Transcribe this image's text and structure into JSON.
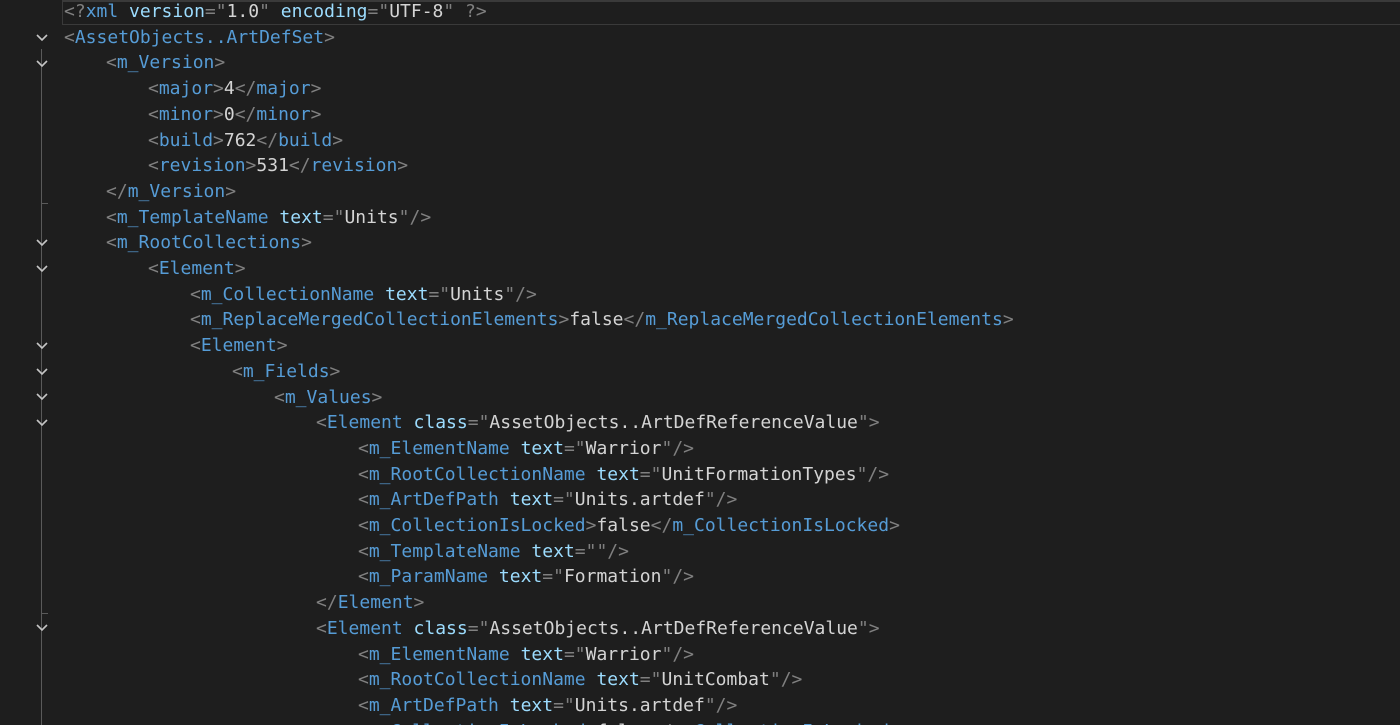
{
  "editor": {
    "lines": [
      {
        "kind": "decl",
        "text": "<?xml version=\"1.0\" encoding=\"UTF-8\" ?>"
      },
      {
        "kind": "open",
        "name": "AssetObjects..ArtDefSet"
      },
      {
        "kind": "open",
        "name": "m_Version"
      },
      {
        "kind": "value",
        "name": "major",
        "value": "4"
      },
      {
        "kind": "value",
        "name": "minor",
        "value": "0"
      },
      {
        "kind": "value",
        "name": "build",
        "value": "762"
      },
      {
        "kind": "value",
        "name": "revision",
        "value": "531"
      },
      {
        "kind": "close",
        "name": "m_Version"
      },
      {
        "kind": "selfclose",
        "name": "m_TemplateName",
        "attr": "text",
        "attrValue": "Units"
      },
      {
        "kind": "open",
        "name": "m_RootCollections"
      },
      {
        "kind": "open",
        "name": "Element"
      },
      {
        "kind": "selfclose",
        "name": "m_CollectionName",
        "attr": "text",
        "attrValue": "Units"
      },
      {
        "kind": "value",
        "name": "m_ReplaceMergedCollectionElements",
        "value": "false"
      },
      {
        "kind": "open",
        "name": "Element"
      },
      {
        "kind": "open",
        "name": "m_Fields"
      },
      {
        "kind": "open",
        "name": "m_Values"
      },
      {
        "kind": "openattr",
        "name": "Element",
        "attr": "class",
        "attrValue": "AssetObjects..ArtDefReferenceValue"
      },
      {
        "kind": "selfclose",
        "name": "m_ElementName",
        "attr": "text",
        "attrValue": "Warrior"
      },
      {
        "kind": "selfclose",
        "name": "m_RootCollectionName",
        "attr": "text",
        "attrValue": "UnitFormationTypes"
      },
      {
        "kind": "selfclose",
        "name": "m_ArtDefPath",
        "attr": "text",
        "attrValue": "Units.artdef"
      },
      {
        "kind": "value",
        "name": "m_CollectionIsLocked",
        "value": "false"
      },
      {
        "kind": "selfclose",
        "name": "m_TemplateName",
        "attr": "text",
        "attrValue": ""
      },
      {
        "kind": "selfclose",
        "name": "m_ParamName",
        "attr": "text",
        "attrValue": "Formation"
      },
      {
        "kind": "close",
        "name": "Element"
      },
      {
        "kind": "openattr",
        "name": "Element",
        "attr": "class",
        "attrValue": "AssetObjects..ArtDefReferenceValue"
      },
      {
        "kind": "selfclose",
        "name": "m_ElementName",
        "attr": "text",
        "attrValue": "Warrior"
      },
      {
        "kind": "selfclose",
        "name": "m_RootCollectionName",
        "attr": "text",
        "attrValue": "UnitCombat"
      },
      {
        "kind": "selfclose",
        "name": "m_ArtDefPath",
        "attr": "text",
        "attrValue": "Units.artdef"
      },
      {
        "kind": "value",
        "name": "m_CollectionIsLocked",
        "value": "false"
      }
    ]
  }
}
